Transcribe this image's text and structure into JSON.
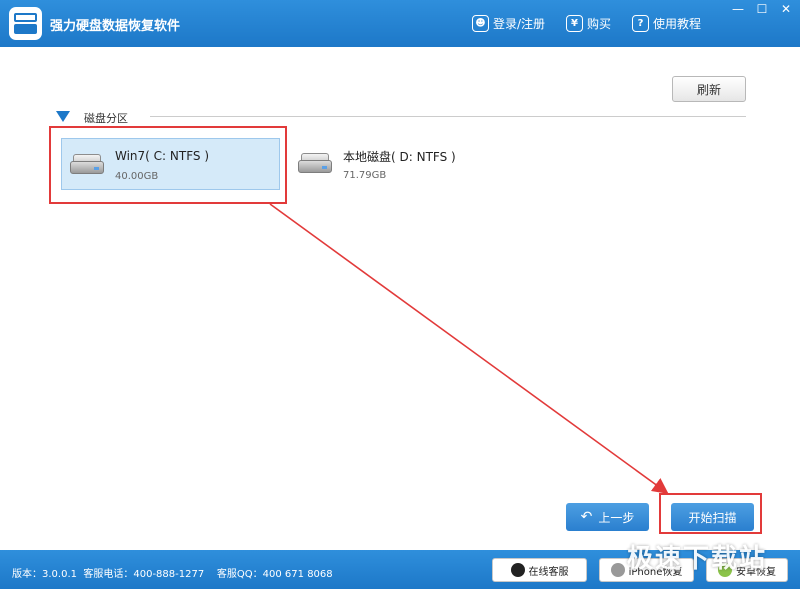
{
  "app": {
    "title": "强力硬盘数据恢复软件"
  },
  "toolbar": {
    "login_label": "登录/注册",
    "buy_label": "购买",
    "buy_icon_glyph": "¥",
    "tutorial_label": "使用教程"
  },
  "window_controls": {
    "minimize": "—",
    "maximize": "☐",
    "close": "✕"
  },
  "main": {
    "refresh_label": "刷新",
    "section_title": "磁盘分区",
    "drives": [
      {
        "name": "Win7( C: NTFS )",
        "size": "40.00GB",
        "selected": true
      },
      {
        "name": "本地磁盘( D: NTFS )",
        "size": "71.79GB",
        "selected": false
      }
    ],
    "back_label": "上一步",
    "scan_label": "开始扫描"
  },
  "status": {
    "version": "版本：3.0.0.1",
    "phone": "客服电话：400-888-1277",
    "qq": "客服QQ：400 671 8068",
    "online_service_label": "在线客服",
    "iphone_label": "iPhone恢复",
    "android_label": "安卓恢复"
  },
  "watermark": "极速下载站",
  "colors": {
    "accent": "#1d78c8",
    "highlight": "#e23a3a",
    "selected_bg": "#d5eaf9"
  }
}
